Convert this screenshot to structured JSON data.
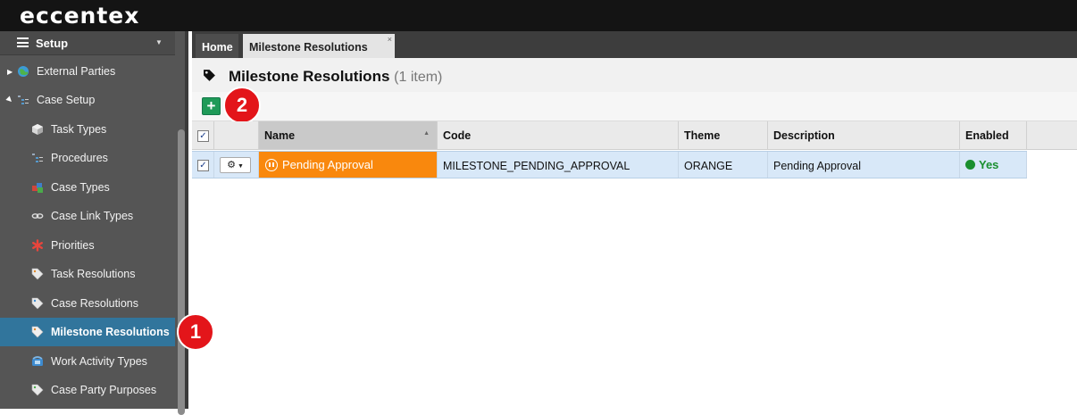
{
  "app": {
    "logo": "eccentex"
  },
  "sidebar": {
    "header": "Setup",
    "items": [
      {
        "label": "External Parties",
        "icon": "globe-icon"
      },
      {
        "label": "Case Setup",
        "icon": "tree-icon"
      },
      {
        "label": "Task Types",
        "icon": "cube-icon"
      },
      {
        "label": "Procedures",
        "icon": "tree-icon"
      },
      {
        "label": "Case Types",
        "icon": "cubes-icon"
      },
      {
        "label": "Case Link Types",
        "icon": "link-icon"
      },
      {
        "label": "Priorities",
        "icon": "asterisk-icon"
      },
      {
        "label": "Task Resolutions",
        "icon": "tag-icon"
      },
      {
        "label": "Case Resolutions",
        "icon": "tag-icon"
      },
      {
        "label": "Milestone Resolutions",
        "icon": "tag-icon",
        "active": true
      },
      {
        "label": "Work Activity Types",
        "icon": "phone-icon"
      },
      {
        "label": "Case Party Purposes",
        "icon": "tag-icon"
      }
    ]
  },
  "tabs": [
    {
      "label": "Home"
    },
    {
      "label": "Milestone Resolutions",
      "close": "×"
    }
  ],
  "page": {
    "title": "Milestone Resolutions",
    "count": "(1 item)"
  },
  "toolbar": {
    "add_label": "+"
  },
  "grid": {
    "columns": [
      "Name",
      "Code",
      "Theme",
      "Description",
      "Enabled"
    ],
    "rows": [
      {
        "name": "Pending Approval",
        "code": "MILESTONE_PENDING_APPROVAL",
        "theme": "ORANGE",
        "description": "Pending Approval",
        "enabled": "Yes"
      }
    ]
  },
  "badges": {
    "one": "1",
    "two": "2"
  },
  "colors": {
    "accent": "#31759c",
    "orange_theme": "#f9880d",
    "add_green": "#1f9a58",
    "enabled_green": "#1a8f2e"
  }
}
